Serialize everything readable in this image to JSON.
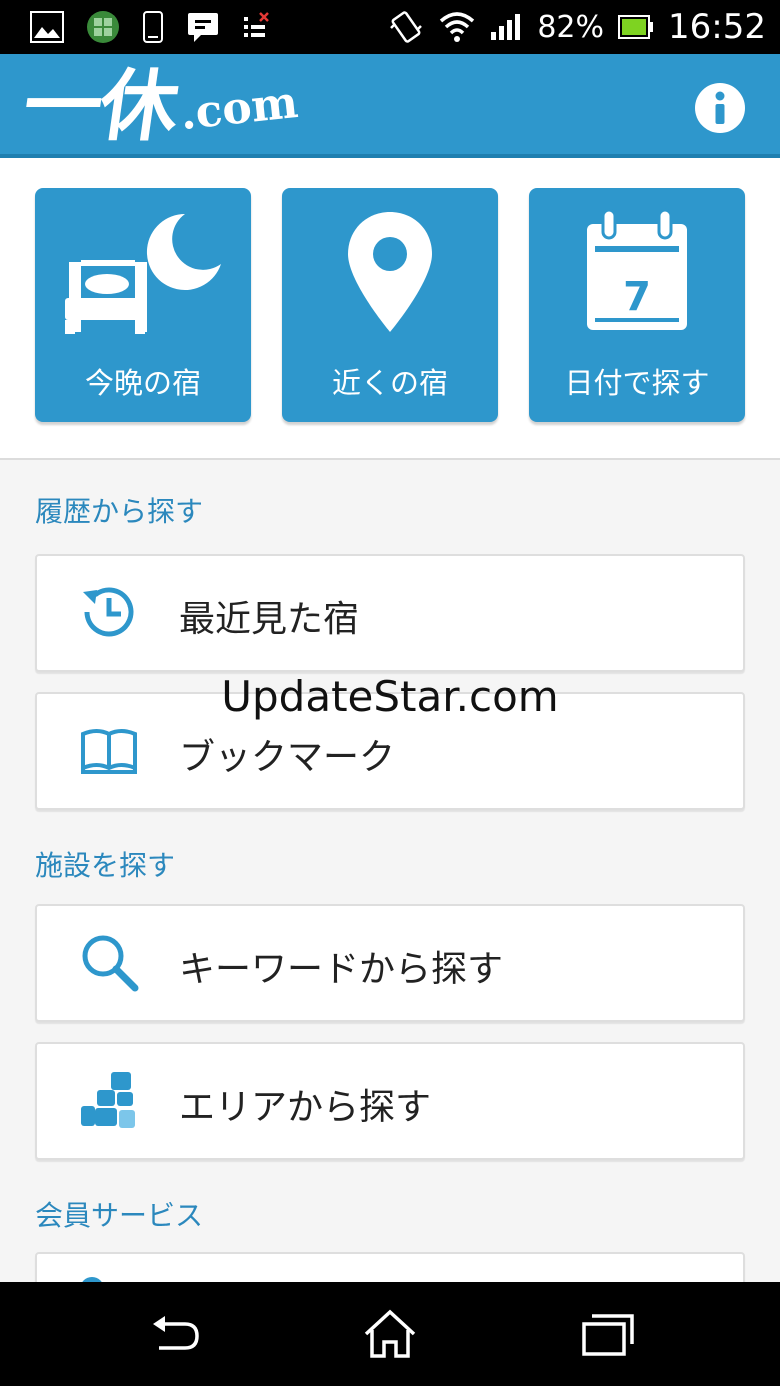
{
  "status_bar": {
    "battery": "82%",
    "time": "16:52"
  },
  "header": {
    "logo_mark": "一休",
    "logo_suffix": ".com",
    "brand_color": "#2e97cc"
  },
  "quick_actions": [
    {
      "label": "今晩の宿",
      "icon": "bed-moon-icon"
    },
    {
      "label": "近くの宿",
      "icon": "map-pin-icon"
    },
    {
      "label": "日付で探す",
      "icon": "calendar-icon",
      "calendar_day": "7"
    }
  ],
  "sections": {
    "history": {
      "title": "履歴から探す",
      "items": [
        {
          "label": "最近見た宿",
          "icon": "history-clock-icon"
        },
        {
          "label": "ブックマーク",
          "icon": "book-icon"
        }
      ]
    },
    "facility": {
      "title": "施設を探す",
      "items": [
        {
          "label": "キーワードから探す",
          "icon": "search-icon"
        },
        {
          "label": "エリアから探す",
          "icon": "area-blocks-icon"
        }
      ]
    },
    "member": {
      "title": "会員サービス"
    }
  },
  "watermark": "UpdateStar.com"
}
